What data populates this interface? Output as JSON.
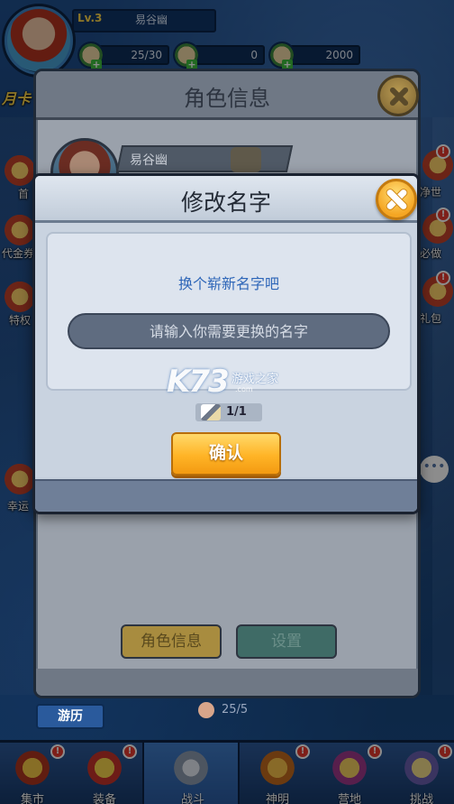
{
  "player": {
    "level": "Lv.3",
    "name": "易谷幽"
  },
  "resources": [
    {
      "icon": "stamina-icon",
      "value": "25/30"
    },
    {
      "icon": "gold-icon",
      "value": "0"
    },
    {
      "icon": "diamond-icon",
      "value": "2000"
    }
  ],
  "left_menu": [
    {
      "label": "月卡"
    },
    {
      "label": "首"
    },
    {
      "label": "代金券"
    },
    {
      "label": "特权"
    },
    {
      "label": "幸运"
    }
  ],
  "right_menu": [
    {
      "label": "净世"
    },
    {
      "label": "必做"
    },
    {
      "label": "礼包"
    }
  ],
  "back_panel": {
    "title": "角色信息",
    "player_name": "易谷幽",
    "buttons": {
      "role_info": "角色信息",
      "settings": "设置"
    }
  },
  "dialog": {
    "title": "修改名字",
    "prompt": "换个崭新名字吧",
    "input_placeholder": "请输入你需要更换的名字",
    "input_value": "",
    "cost": "1/1",
    "confirm": "确认"
  },
  "watermark": {
    "brand": "K73",
    "cn": "游戏之家",
    "url": ".com"
  },
  "energy": "25/5",
  "travel_label": "游历",
  "bottom_nav": [
    {
      "label": "集市",
      "icon": "market-icon"
    },
    {
      "label": "装备",
      "icon": "equipment-icon"
    },
    {
      "label": "战斗",
      "icon": "battle-icon"
    },
    {
      "label": "神明",
      "icon": "deity-icon"
    },
    {
      "label": "营地",
      "icon": "camp-icon"
    },
    {
      "label": "挑战",
      "icon": "challenge-icon"
    }
  ],
  "colors": {
    "confirm": "#ffb426",
    "close": "#f5a623",
    "prompt": "#2e66b8",
    "badge": "#e63a2e"
  }
}
